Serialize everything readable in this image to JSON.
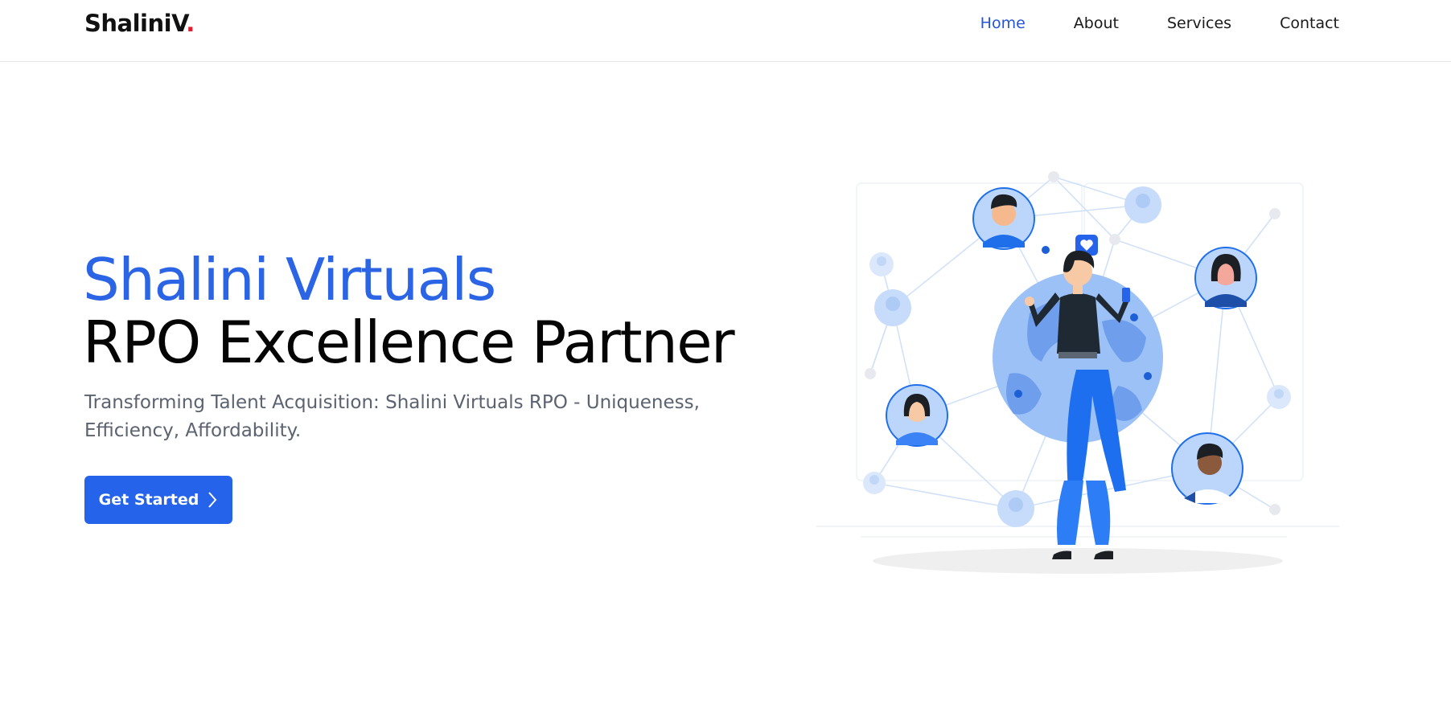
{
  "brand": {
    "name": "ShaliniV",
    "dot": "."
  },
  "nav": {
    "items": [
      {
        "label": "Home",
        "active": true
      },
      {
        "label": "About",
        "active": false
      },
      {
        "label": "Services",
        "active": false
      },
      {
        "label": "Contact",
        "active": false
      }
    ]
  },
  "hero": {
    "title_line1": "Shalini Virtuals",
    "title_line2": "RPO Excellence Partner",
    "subtitle": "Transforming Talent Acquisition: Shalini Virtuals RPO - Uniqueness, Efficiency, Affordability.",
    "cta_label": "Get Started",
    "cta_icon": "chevron-right-icon"
  },
  "colors": {
    "accent": "#2563eb",
    "title_blue": "#2b65e6",
    "nav_active": "#2454d8",
    "brand_dot": "#e11d2e",
    "subtitle_gray": "#5b6270"
  },
  "illustration": {
    "icon": "people-network-globe-illustration"
  }
}
